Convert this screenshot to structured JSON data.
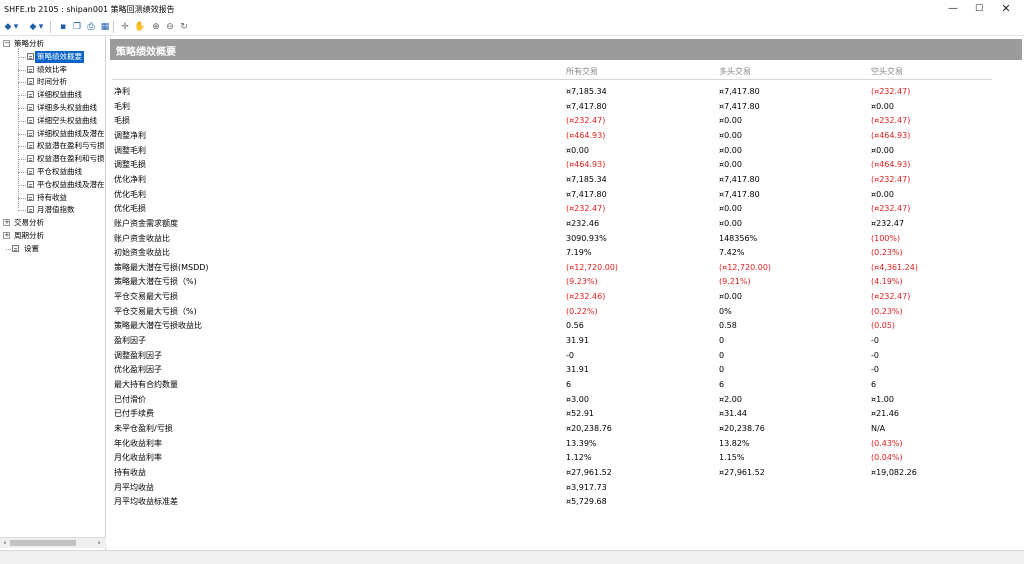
{
  "window": {
    "title": "SHFE.rb 2105 : shipan001 策略回测绩效报告"
  },
  "toolbar": {
    "buttons": [
      {
        "icon": "back-icon",
        "glyph": "◆"
      },
      {
        "icon": "back-dropdown-icon",
        "glyph": "▾"
      },
      {
        "icon": "forward-icon",
        "glyph": "◆"
      },
      {
        "icon": "forward-dropdown-icon",
        "glyph": "▾"
      },
      {
        "icon": "save-icon",
        "glyph": "▪"
      },
      {
        "icon": "copy-icon",
        "glyph": "❐"
      },
      {
        "icon": "print-icon",
        "glyph": "⎙"
      },
      {
        "icon": "table-icon",
        "glyph": "▦"
      },
      {
        "icon": "crosshair-icon",
        "glyph": "✛"
      },
      {
        "icon": "hand-pan-icon",
        "glyph": "✋"
      },
      {
        "icon": "zoom-in-icon",
        "glyph": "⊕"
      },
      {
        "icon": "zoom-out-icon",
        "glyph": "⊖"
      },
      {
        "icon": "refresh-icon",
        "glyph": "↻"
      }
    ]
  },
  "tree": {
    "root": {
      "label": "策略分析",
      "expand": "−"
    },
    "children": [
      "策略绩效概要",
      "绩效比率",
      "时间分析",
      "详细权益曲线",
      "详细多头权益曲线",
      "详细空头权益曲线",
      "详细权益曲线及潜在",
      "权益潜在盈利与亏损",
      "权益潜在盈利和亏损",
      "平仓权益曲线",
      "平仓权益曲线及潜在",
      "持有收益",
      "月潜值指数"
    ],
    "groups": [
      {
        "label": "交易分析",
        "expand": "+"
      },
      {
        "label": "周期分析",
        "expand": "+"
      }
    ],
    "settings": "设置"
  },
  "report": {
    "title": "策略绩效概要",
    "columns": [
      "所有交易",
      "多头交易",
      "空头交易"
    ],
    "rows": [
      {
        "label": "净利",
        "values": [
          "¤7,185.34",
          "¤7,417.80",
          "(¤232.47)"
        ]
      },
      {
        "label": "毛利",
        "values": [
          "¤7,417.80",
          "¤7,417.80",
          "¤0.00"
        ]
      },
      {
        "label": "毛损",
        "values": [
          "(¤232.47)",
          "¤0.00",
          "(¤232.47)"
        ]
      },
      {
        "label": "调整净利",
        "values": [
          "(¤464.93)",
          "¤0.00",
          "(¤464.93)"
        ]
      },
      {
        "label": "调整毛利",
        "values": [
          "¤0.00",
          "¤0.00",
          "¤0.00"
        ]
      },
      {
        "label": "调整毛损",
        "values": [
          "(¤464.93)",
          "¤0.00",
          "(¤464.93)"
        ]
      },
      {
        "label": "优化净利",
        "values": [
          "¤7,185.34",
          "¤7,417.80",
          "(¤232.47)"
        ]
      },
      {
        "label": "优化毛利",
        "values": [
          "¤7,417.80",
          "¤7,417.80",
          "¤0.00"
        ]
      },
      {
        "label": "优化毛损",
        "values": [
          "(¤232.47)",
          "¤0.00",
          "(¤232.47)"
        ]
      },
      {
        "label": "账户资金需求额度",
        "values": [
          "¤232.46",
          "¤0.00",
          "¤232.47"
        ]
      },
      {
        "label": "账户资金收益比",
        "values": [
          "3090.93%",
          "148356%",
          "(100%)"
        ]
      },
      {
        "label": "初始资金收益比",
        "values": [
          "7.19%",
          "7.42%",
          "(0.23%)"
        ]
      },
      {
        "label": "策略最大潜在亏损(MSDD)",
        "values": [
          "(¤12,720.00)",
          "(¤12,720.00)",
          "(¤4,361.24)"
        ]
      },
      {
        "label": "策略最大潜在亏损（%)",
        "values": [
          "(9.23%)",
          "(9.21%)",
          "(4.19%)"
        ]
      },
      {
        "label": "平仓交易最大亏损",
        "values": [
          "(¤232.46)",
          "¤0.00",
          "(¤232.47)"
        ]
      },
      {
        "label": "平仓交易最大亏损（%)",
        "values": [
          "(0.22%)",
          "0%",
          "(0.23%)"
        ]
      },
      {
        "label": "策略最大潜在亏损收益比",
        "values": [
          "0.56",
          "0.58",
          "(0.05)"
        ]
      },
      {
        "label": "盈利因子",
        "values": [
          "31.91",
          "0",
          "-0"
        ]
      },
      {
        "label": "调整盈利因子",
        "values": [
          "-0",
          "0",
          "-0"
        ]
      },
      {
        "label": "优化盈利因子",
        "values": [
          "31.91",
          "0",
          "-0"
        ]
      },
      {
        "label": "最大持有合约数量",
        "values": [
          "6",
          "6",
          "6"
        ]
      },
      {
        "label": "已付滑价",
        "values": [
          "¤3.00",
          "¤2.00",
          "¤1.00"
        ]
      },
      {
        "label": "已付手续费",
        "values": [
          "¤52.91",
          "¤31.44",
          "¤21.46"
        ]
      },
      {
        "label": "未平仓盈利/亏损",
        "values": [
          "¤20,238.76",
          "¤20,238.76",
          "N/A"
        ]
      },
      {
        "label": "年化收益利率",
        "values": [
          "13.39%",
          "13.82%",
          "(0.43%)"
        ]
      },
      {
        "label": "月化收益利率",
        "values": [
          "1.12%",
          "1.15%",
          "(0.04%)"
        ]
      },
      {
        "label": "持有收益",
        "values": [
          "¤27,961.52",
          "¤27,961.52",
          "¤19,082.26"
        ]
      },
      {
        "label": "月平均收益",
        "values": [
          "¤3,917.73",
          "",
          ""
        ]
      },
      {
        "label": "月平均收益标准差",
        "values": [
          "¤5,729.68",
          "",
          ""
        ]
      }
    ]
  },
  "colors": {
    "negative": "#e02020",
    "header_bg": "#9b9b9b",
    "selection": "#0a64c8"
  }
}
